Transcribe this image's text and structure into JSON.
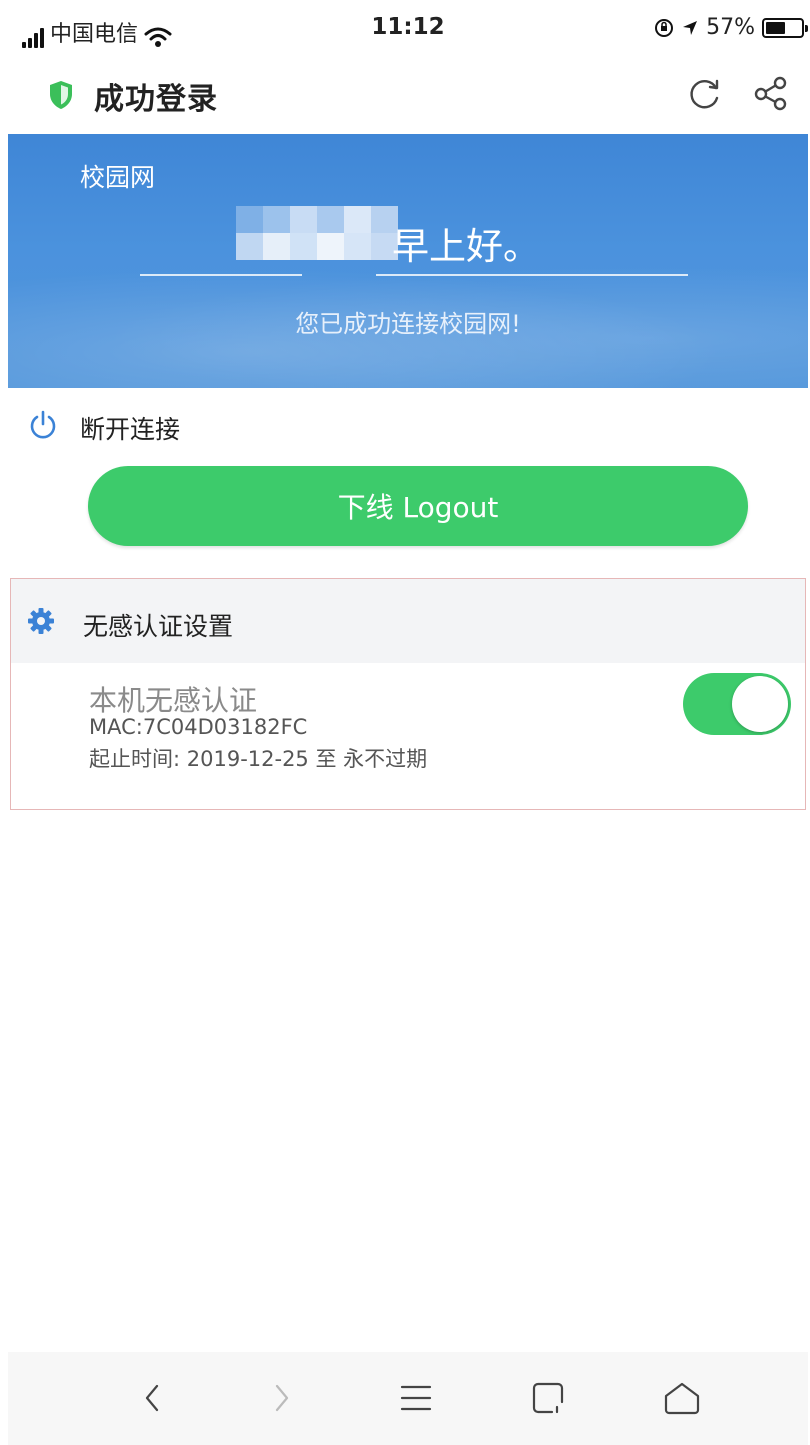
{
  "status_bar": {
    "carrier": "中国电信",
    "time": "11:12",
    "battery": "57%",
    "battery_level": 0.57,
    "icons": [
      "signal-icon",
      "wifi-icon",
      "orientation-lock-icon",
      "location-icon",
      "battery-icon"
    ]
  },
  "title_bar": {
    "title": "成功登录",
    "icons": [
      "shield-icon",
      "refresh-icon",
      "share-icon"
    ]
  },
  "banner": {
    "site_name": "校园网",
    "greeting": "早上好。",
    "status": "您已成功连接校园网!"
  },
  "disconnect": {
    "label": "断开连接",
    "logout_label": "下线 Logout",
    "icon": "power-icon"
  },
  "auth_settings": {
    "title": "无感认证设置",
    "icon": "gear-icon",
    "device_name": "本机无感认证",
    "mac": "MAC:7C04D03182FC",
    "period": "起止时间: 2019-12-25 至 永不过期",
    "enabled": true
  },
  "bottom_nav": {
    "icons": [
      "back-icon",
      "forward-icon",
      "menu-icon",
      "tabs-icon",
      "home-icon"
    ]
  },
  "colors": {
    "banner_blue": "#4a8fdc",
    "accent_green": "#3dcb6b",
    "shield_green": "#3bbf5a",
    "icon_blue": "#3b82d6"
  }
}
